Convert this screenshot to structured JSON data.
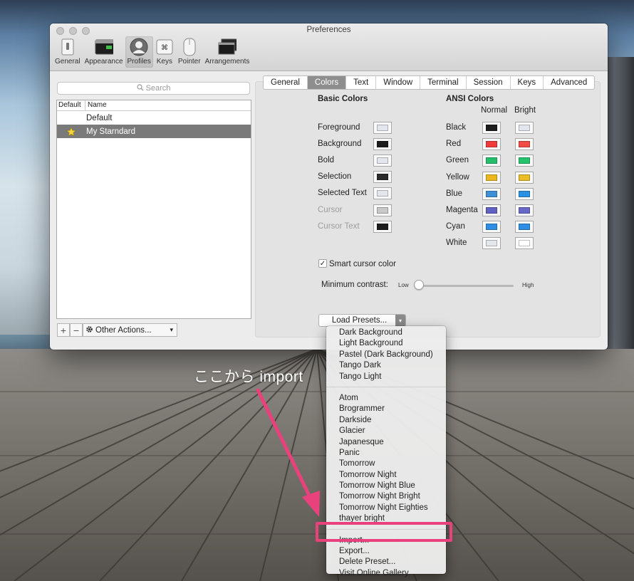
{
  "window": {
    "title": "Preferences"
  },
  "toolbar": {
    "items": [
      {
        "label": "General",
        "icon": "switch-icon"
      },
      {
        "label": "Appearance",
        "icon": "appearance-icon"
      },
      {
        "label": "Profiles",
        "icon": "profiles-icon"
      },
      {
        "label": "Keys",
        "icon": "keys-icon"
      },
      {
        "label": "Pointer",
        "icon": "pointer-icon"
      },
      {
        "label": "Arrangements",
        "icon": "arrangements-icon"
      }
    ],
    "selected": "Profiles"
  },
  "profiles": {
    "search_placeholder": "Search",
    "columns": {
      "default": "Default",
      "name": "Name"
    },
    "rows": [
      {
        "name": "Default",
        "is_default": false
      },
      {
        "name": "My Starndard",
        "is_default": true,
        "selected": true
      }
    ],
    "add_label": "+",
    "remove_label": "−",
    "other_actions": "Other Actions..."
  },
  "tabs": [
    "General",
    "Colors",
    "Text",
    "Window",
    "Terminal",
    "Session",
    "Keys",
    "Advanced"
  ],
  "selected_tab": "Colors",
  "basic_colors": {
    "title": "Basic Colors",
    "items": [
      {
        "label": "Foreground",
        "color": "#e4e6ee"
      },
      {
        "label": "Background",
        "color": "#1d1d1d"
      },
      {
        "label": "Bold",
        "color": "#e4e6ee"
      },
      {
        "label": "Selection",
        "color": "#2b2b2b"
      },
      {
        "label": "Selected Text",
        "color": "#e4e6ee"
      },
      {
        "label": "Cursor",
        "color": "#c9c9c9",
        "disabled": true
      },
      {
        "label": "Cursor Text",
        "color": "#1d1d1d",
        "disabled": true
      }
    ]
  },
  "ansi_colors": {
    "title": "ANSI Colors",
    "normal_label": "Normal",
    "bright_label": "Bright",
    "items": [
      {
        "label": "Black",
        "normal": "#1d1d1d",
        "bright": "#e4e6ee"
      },
      {
        "label": "Red",
        "normal": "#f03b3b",
        "bright": "#f24b45"
      },
      {
        "label": "Green",
        "normal": "#25be6a",
        "bright": "#25c36b"
      },
      {
        "label": "Yellow",
        "normal": "#ebb71e",
        "bright": "#ecbc24"
      },
      {
        "label": "Blue",
        "normal": "#3d8fd6",
        "bright": "#2a92e4"
      },
      {
        "label": "Magenta",
        "normal": "#6161c1",
        "bright": "#6868c8"
      },
      {
        "label": "Cyan",
        "normal": "#2f8ee3",
        "bright": "#2f8ee3"
      },
      {
        "label": "White",
        "normal": "#e4e6ee",
        "bright": "#ffffff"
      }
    ]
  },
  "smart_cursor": {
    "label": "Smart cursor color",
    "checked": true
  },
  "contrast": {
    "label": "Minimum contrast:",
    "low": "Low",
    "high": "High",
    "value": 0
  },
  "load_presets": "Load Presets...",
  "menu": {
    "group1": [
      "Dark Background",
      "Light Background",
      "Pastel (Dark Background)",
      "Tango Dark",
      "Tango Light"
    ],
    "group2": [
      "Atom",
      "Brogrammer",
      "Darkside",
      "Glacier",
      "Japanesque",
      "Panic",
      "Tomorrow",
      "Tomorrow Night",
      "Tomorrow Night Blue",
      "Tomorrow Night Bright",
      "Tomorrow Night Eighties",
      "thayer bright"
    ],
    "group3": [
      "Import...",
      "Export...",
      "Delete Preset...",
      "Visit Online Gallery"
    ]
  },
  "annotation": {
    "text": "ここから import",
    "color": "#e8417c"
  }
}
